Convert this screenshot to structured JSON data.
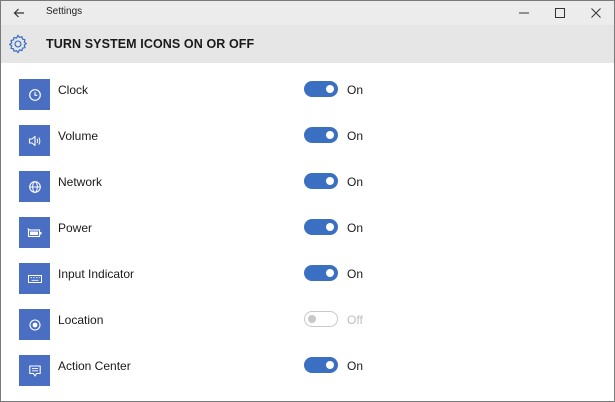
{
  "window": {
    "title": "Settings"
  },
  "header": {
    "title": "TURN SYSTEM ICONS ON OR OFF"
  },
  "colors": {
    "accent": "#3b6fc2",
    "tile": "#4a6ec2",
    "disabled": "#c8c8c8"
  },
  "items": [
    {
      "label": "Clock",
      "icon": "clock-icon",
      "state": "On",
      "enabled": true
    },
    {
      "label": "Volume",
      "icon": "volume-icon",
      "state": "On",
      "enabled": true
    },
    {
      "label": "Network",
      "icon": "network-globe-icon",
      "state": "On",
      "enabled": true
    },
    {
      "label": "Power",
      "icon": "battery-icon",
      "state": "On",
      "enabled": true
    },
    {
      "label": "Input Indicator",
      "icon": "keyboard-icon",
      "state": "On",
      "enabled": true
    },
    {
      "label": "Location",
      "icon": "location-icon",
      "state": "Off",
      "enabled": false
    },
    {
      "label": "Action Center",
      "icon": "action-center-icon",
      "state": "On",
      "enabled": true
    }
  ]
}
